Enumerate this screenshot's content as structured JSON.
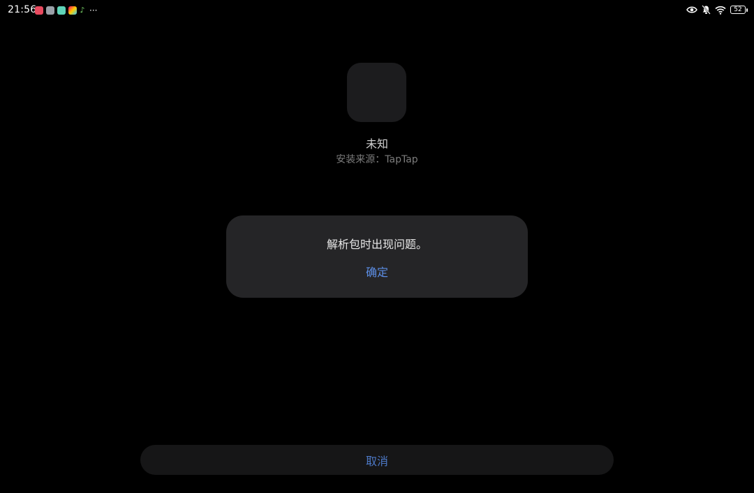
{
  "status_bar": {
    "time": "21:56",
    "more": "···",
    "battery": "52",
    "notification_icons": [
      "red-app-icon",
      "settings-app-icon",
      "camera-app-icon",
      "gallery-app-icon",
      "music-app-icon"
    ],
    "system_icons": [
      "eye-icon",
      "bell-off-icon",
      "wifi-icon",
      "battery-icon"
    ]
  },
  "app": {
    "name": "未知",
    "source": "安装来源：TapTap"
  },
  "dialog": {
    "message": "解析包时出现问题。",
    "confirm_label": "确定"
  },
  "bottom": {
    "cancel_label": "取消"
  },
  "colors": {
    "background": "#000000",
    "dialog": "#252527",
    "accent": "#5c8ee6"
  }
}
